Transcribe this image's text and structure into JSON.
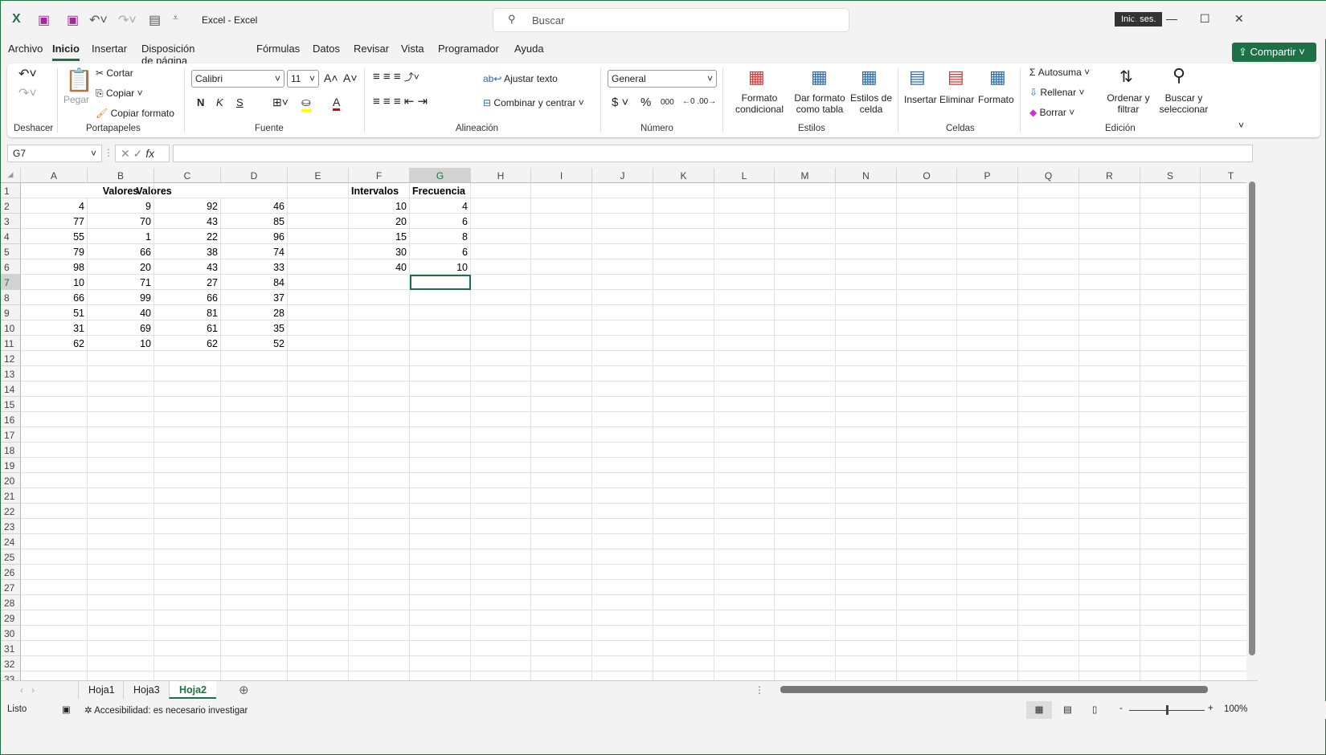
{
  "titlebar": {
    "title": "Excel  -  Excel",
    "search_placeholder": "Buscar",
    "signin": "Inic. ses."
  },
  "menu": [
    "Archivo",
    "Inicio",
    "Insertar",
    "Disposición de página",
    "Fórmulas",
    "Datos",
    "Revisar",
    "Vista",
    "Programador",
    "Ayuda"
  ],
  "share": "Compartir",
  "ribbon": {
    "undo_group": "Deshacer",
    "clipboard": {
      "paste": "Pegar",
      "cut": "Cortar",
      "copy": "Copiar",
      "format_painter": "Copiar formato",
      "group": "Portapapeles"
    },
    "font": {
      "name": "Calibri",
      "size": "11",
      "bold": "N",
      "italic": "K",
      "underline": "S",
      "group": "Fuente"
    },
    "alignment": {
      "wrap": "Ajustar texto",
      "merge": "Combinar y centrar",
      "group": "Alineación"
    },
    "number": {
      "format": "General",
      "currency": "$",
      "percent": "%",
      "thousands": "000",
      "group": "Número"
    },
    "styles": {
      "conditional": "Formato condicional",
      "as_table": "Dar formato como tabla",
      "cell_styles": "Estilos de celda",
      "group": "Estilos"
    },
    "cells": {
      "insert": "Insertar",
      "delete": "Eliminar",
      "format": "Formato",
      "group": "Celdas"
    },
    "editing": {
      "autosum": "Autosuma",
      "fill": "Rellenar",
      "clear": "Borrar",
      "sort": "Ordenar y filtrar",
      "find": "Buscar y seleccionar",
      "group": "Edición"
    }
  },
  "formula_bar": {
    "name_box": "G7",
    "fx": "fx",
    "value": ""
  },
  "sheet": {
    "columns": [
      "A",
      "B",
      "C",
      "D",
      "E",
      "F",
      "G",
      "H",
      "I",
      "J",
      "K",
      "L",
      "M",
      "N",
      "O",
      "P",
      "Q",
      "R",
      "S",
      "T"
    ],
    "row_count": 33,
    "selected": "G7",
    "header_values": {
      "B1": "Valores",
      "F1": "Intervalos",
      "G1": "Frecuencia"
    },
    "values": [
      [
        4,
        9,
        92,
        46
      ],
      [
        77,
        70,
        43,
        85
      ],
      [
        55,
        1,
        22,
        96
      ],
      [
        79,
        66,
        38,
        74
      ],
      [
        98,
        20,
        43,
        33
      ],
      [
        10,
        71,
        27,
        84
      ],
      [
        66,
        99,
        66,
        37
      ],
      [
        51,
        40,
        81,
        28
      ],
      [
        31,
        69,
        61,
        35
      ],
      [
        62,
        10,
        62,
        52
      ]
    ],
    "intervals": [
      [
        10,
        4
      ],
      [
        20,
        6
      ],
      [
        15,
        8
      ],
      [
        30,
        6
      ],
      [
        40,
        10
      ]
    ]
  },
  "sheet_tabs": [
    "Hoja1",
    "Hoja3",
    "Hoja2"
  ],
  "active_sheet": "Hoja2",
  "status": {
    "ready": "Listo",
    "accessibility": "Accesibilidad: es necesario investigar",
    "zoom": "100%"
  }
}
